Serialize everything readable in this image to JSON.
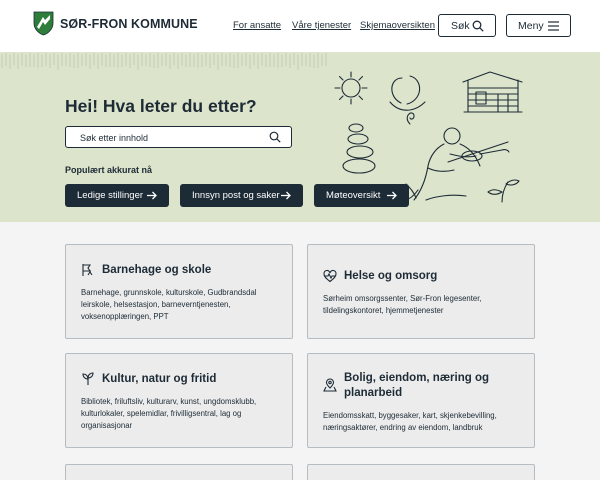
{
  "header": {
    "logo_text": "SØR-FRON KOMMUNE",
    "nav": [
      "For ansatte",
      "Våre tjenester",
      "Skjemaoversikten"
    ],
    "search_button": "Søk",
    "menu_button": "Meny"
  },
  "hero": {
    "title": "Hei! Hva leter du etter?",
    "search_placeholder": "Søk etter innhold",
    "popular_label": "Populært akkurat nå",
    "quick_links": [
      "Ledige stillinger",
      "Innsyn post og saker",
      "Møteoversikt"
    ]
  },
  "cards": [
    {
      "title": "Barnehage og skole",
      "description": "Barnehage, grunnskole, kulturskole, Gudbrandsdal leirskole, helsestasjon, barneverntjenesten, voksenopplæringen, PPT",
      "icon": "child-icon"
    },
    {
      "title": "Helse og omsorg",
      "description": "Sørheim omsorgssenter, Sør-Fron legesenter, tildelingskontoret, hjemmetjenester",
      "icon": "heart-pulse-icon"
    },
    {
      "title": "Kultur, natur og fritid",
      "description": "Bibliotek, friluftsliv, kulturarv, kunst, ungdomsklubb, kulturlokaler, spelemidlar, frivilligsentral, lag og organisasjonar",
      "icon": "sprout-icon"
    },
    {
      "title": "Bolig, eiendom, næring og planarbeid",
      "description": "Eiendomsskatt, byggesaker, kart, skjenkebevilling, næringsaktører, endring av eiendom, landbruk",
      "icon": "map-pin-icon"
    }
  ],
  "colors": {
    "dark": "#1d2b36",
    "hero_bg": "#dde4cc",
    "card_bg": "#ececec",
    "logo_green": "#2e7d3a"
  }
}
